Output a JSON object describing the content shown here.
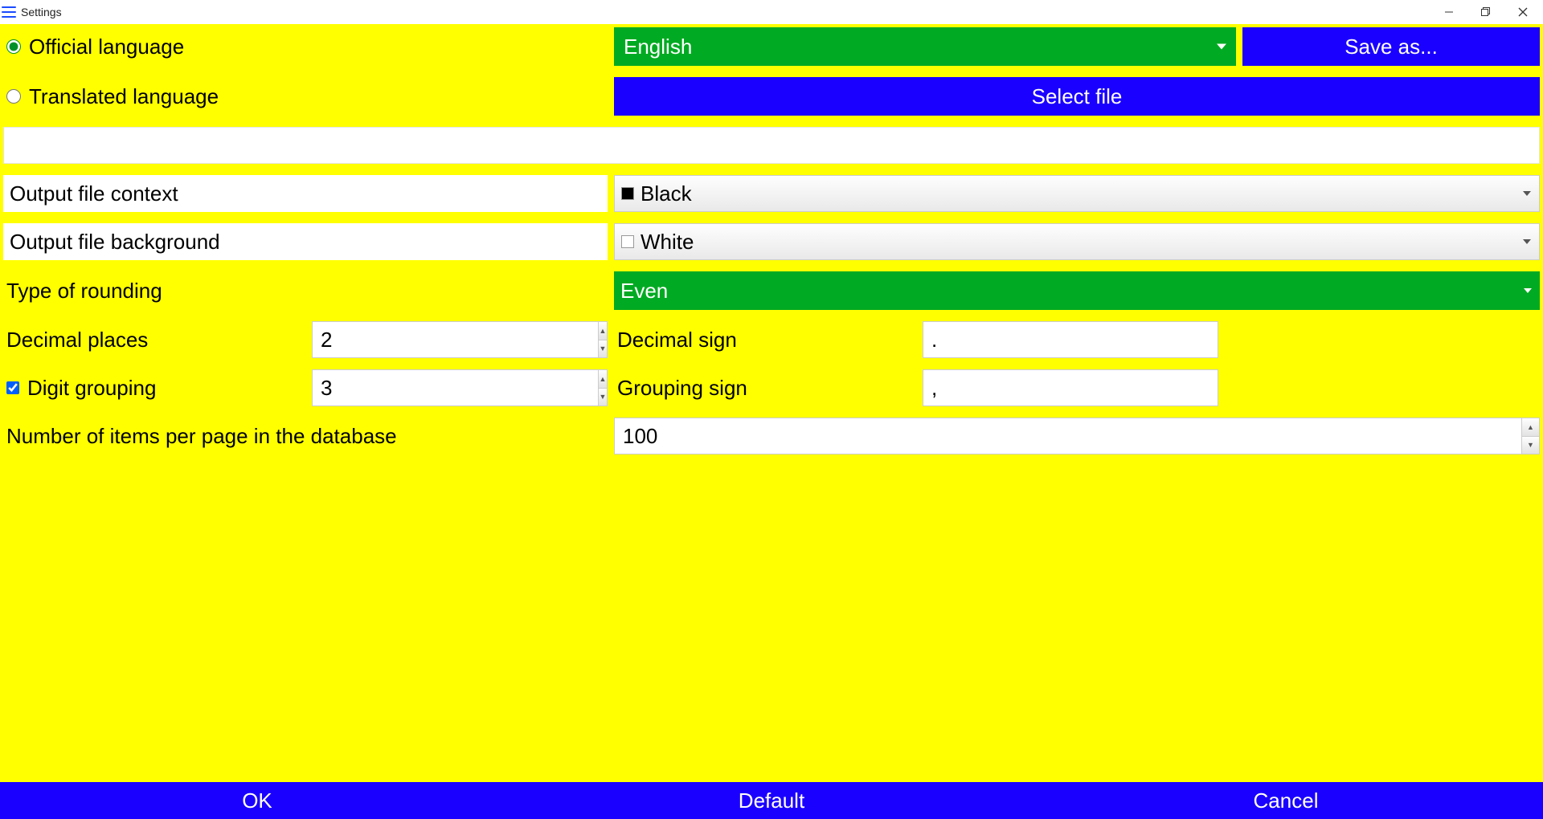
{
  "window": {
    "title": "Settings"
  },
  "lang": {
    "official_label": "Official language",
    "translated_label": "Translated language",
    "selected": "English",
    "save_as": "Save as...",
    "select_file": "Select file"
  },
  "output": {
    "context_label": "Output file context",
    "context_value": "Black",
    "background_label": "Output file background",
    "background_value": "White"
  },
  "rounding": {
    "type_label": "Type of rounding",
    "type_value": "Even"
  },
  "decimal": {
    "places_label": "Decimal places",
    "places_value": "2",
    "sign_label": "Decimal sign",
    "sign_value": "."
  },
  "grouping": {
    "check_label": "Digit grouping",
    "digits_value": "3",
    "sign_label": "Grouping sign",
    "sign_value": ","
  },
  "paging": {
    "label": "Number of items per page in the database",
    "value": "100"
  },
  "footer": {
    "ok": "OK",
    "default": "Default",
    "cancel": "Cancel"
  }
}
